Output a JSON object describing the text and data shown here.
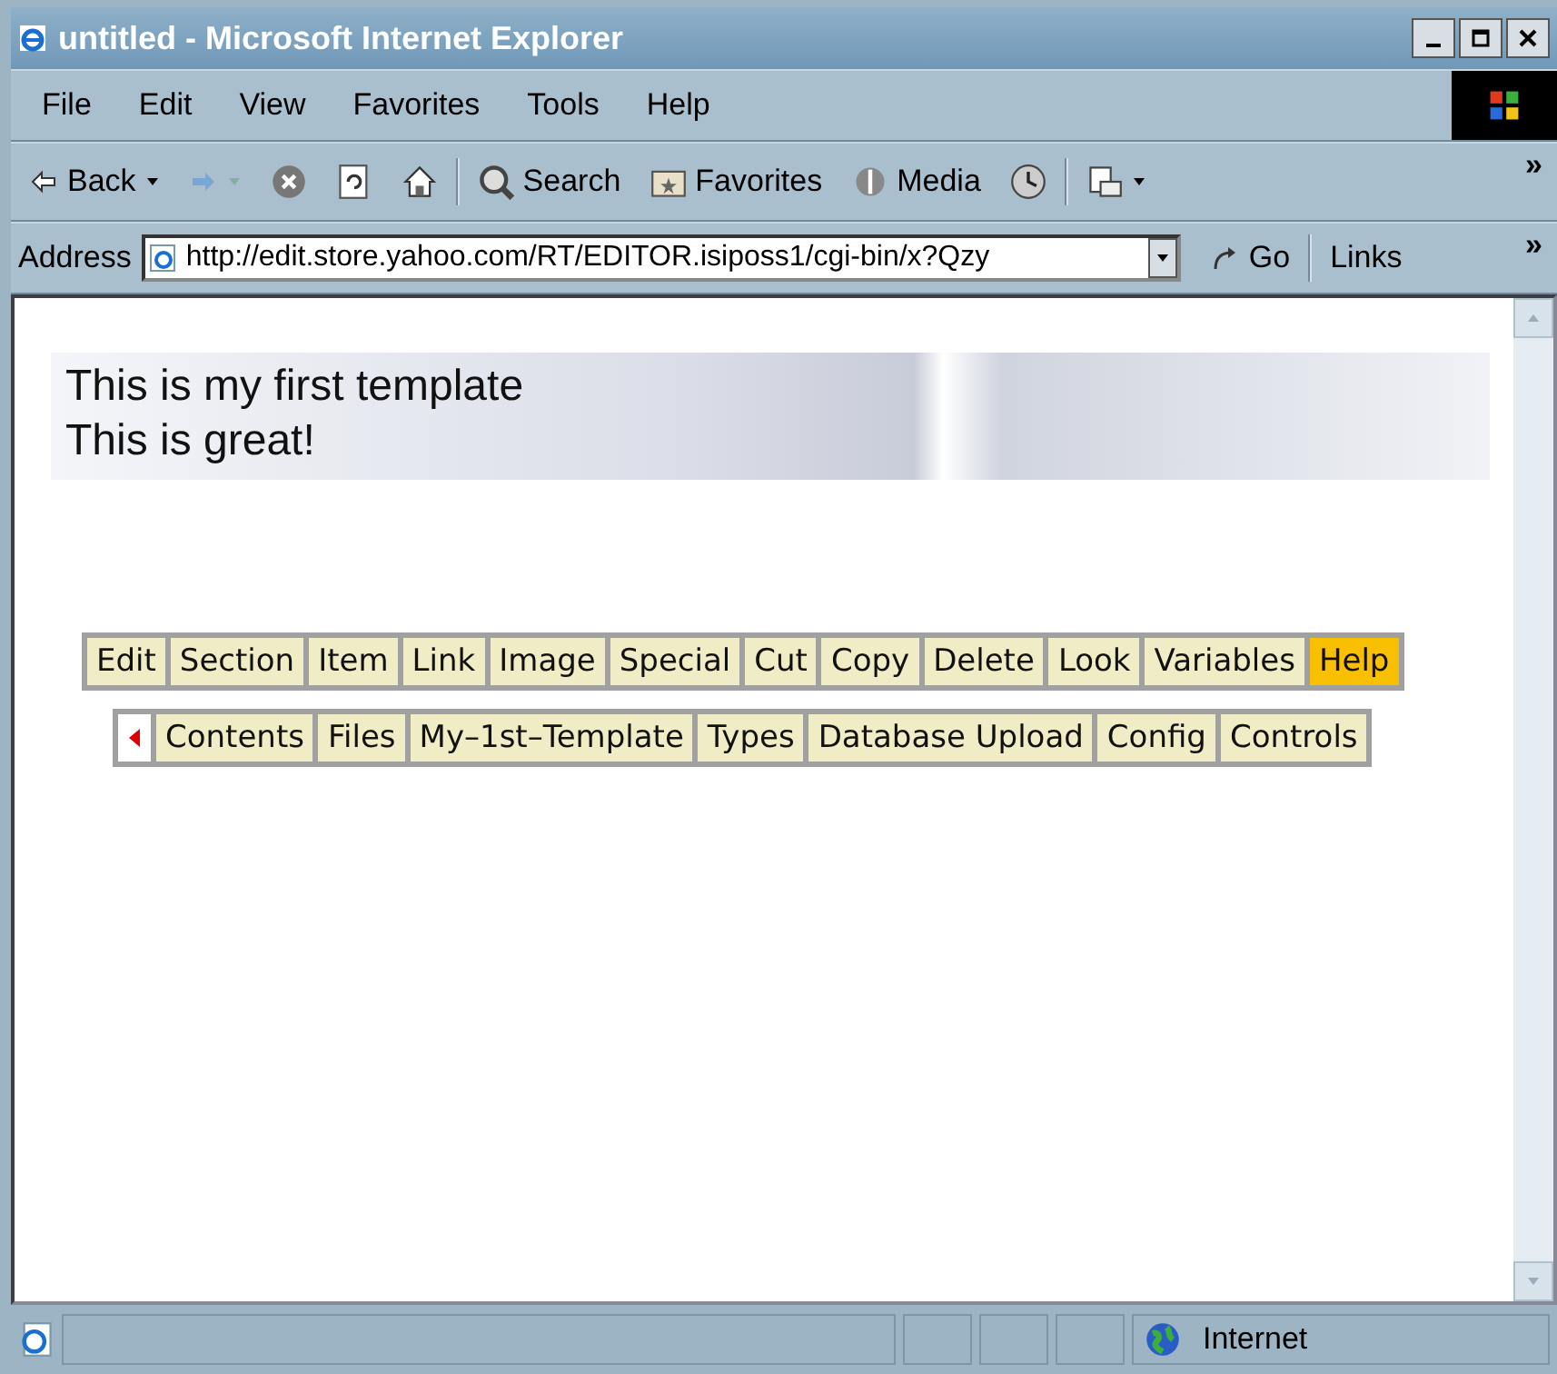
{
  "window": {
    "title": "untitled - Microsoft Internet Explorer"
  },
  "menu": [
    "File",
    "Edit",
    "View",
    "Favorites",
    "Tools",
    "Help"
  ],
  "toolbar": [
    {
      "kind": "back",
      "label": "Back"
    },
    {
      "kind": "forward"
    },
    {
      "kind": "stop"
    },
    {
      "kind": "refresh"
    },
    {
      "kind": "home"
    },
    {
      "kind": "search",
      "label": "Search"
    },
    {
      "kind": "favorites",
      "label": "Favorites"
    },
    {
      "kind": "media",
      "label": "Media"
    },
    {
      "kind": "history"
    },
    {
      "kind": "mail"
    }
  ],
  "toolbar_more": "»",
  "address": {
    "label": "Address",
    "value": "http://edit.store.yahoo.com/RT/EDITOR.isiposs1/cgi-bin/x?Qzy",
    "go": "Go",
    "links": "Links",
    "links_more": "»"
  },
  "banner": [
    "This is my first template",
    "This is great!"
  ],
  "nav_primary": [
    {
      "label": "Edit",
      "selected": false
    },
    {
      "label": "Section",
      "selected": false
    },
    {
      "label": "Item",
      "selected": false
    },
    {
      "label": "Link",
      "selected": false
    },
    {
      "label": "Image",
      "selected": false
    },
    {
      "label": "Special",
      "selected": false
    },
    {
      "label": "Cut",
      "selected": false
    },
    {
      "label": "Copy",
      "selected": false
    },
    {
      "label": "Delete",
      "selected": false
    },
    {
      "label": "Look",
      "selected": false
    },
    {
      "label": "Variables",
      "selected": false
    },
    {
      "label": "Help",
      "selected": true
    }
  ],
  "nav_secondary": [
    {
      "label": "Contents",
      "selected": false
    },
    {
      "label": "Files",
      "selected": false
    },
    {
      "label": "My–1st–Template",
      "selected": false
    },
    {
      "label": "Types",
      "selected": false
    },
    {
      "label": "Database Upload",
      "selected": false
    },
    {
      "label": "Config",
      "selected": false
    },
    {
      "label": "Controls",
      "selected": false
    }
  ],
  "status_bar": {
    "zone": "Internet"
  }
}
